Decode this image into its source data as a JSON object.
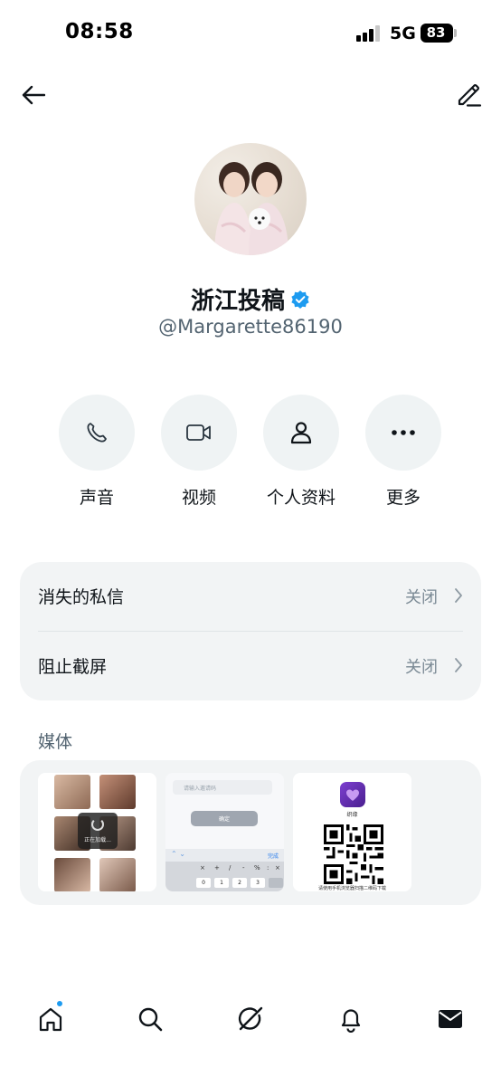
{
  "status_bar": {
    "time": "08:58",
    "network": "5G",
    "battery": "83"
  },
  "header": {
    "back_icon": "arrow-left-icon",
    "edit_icon": "edit-pencil-icon"
  },
  "profile": {
    "name": "浙江投稿",
    "verified": true,
    "handle": "@Margarette86190"
  },
  "actions": [
    {
      "label": "声音",
      "icon": "phone-icon"
    },
    {
      "label": "视频",
      "icon": "video-icon"
    },
    {
      "label": "个人资料",
      "icon": "person-icon"
    },
    {
      "label": "更多",
      "icon": "more-dots-icon"
    }
  ],
  "settings": [
    {
      "title": "消失的私信",
      "value": "关闭"
    },
    {
      "title": "阻止截屏",
      "value": "关闭"
    }
  ],
  "media": {
    "title": "媒体",
    "thumb1": {
      "loading_text": "正在加载..."
    },
    "thumb2": {
      "input_placeholder": "请输入邀请码",
      "confirm_label": "确定",
      "done_label": "完成",
      "keys": [
        "0",
        "1",
        "2",
        "3"
      ],
      "symbols": [
        "×",
        "+",
        "/",
        "-",
        "%",
        ":",
        "×"
      ]
    },
    "thumb3": {
      "app_name": "织缘",
      "caption": "请使用手机浏览器扫描二维码下载"
    }
  },
  "bottom_nav": [
    {
      "name": "home",
      "icon": "home-icon",
      "has_badge": true
    },
    {
      "name": "search",
      "icon": "search-icon"
    },
    {
      "name": "grok",
      "icon": "grok-icon"
    },
    {
      "name": "notifications",
      "icon": "bell-icon"
    },
    {
      "name": "messages",
      "icon": "mail-icon",
      "active": true
    }
  ],
  "colors": {
    "accent": "#1d9bf0",
    "text": "#0f1419",
    "secondary": "#536471",
    "card": "#f2f4f5"
  }
}
